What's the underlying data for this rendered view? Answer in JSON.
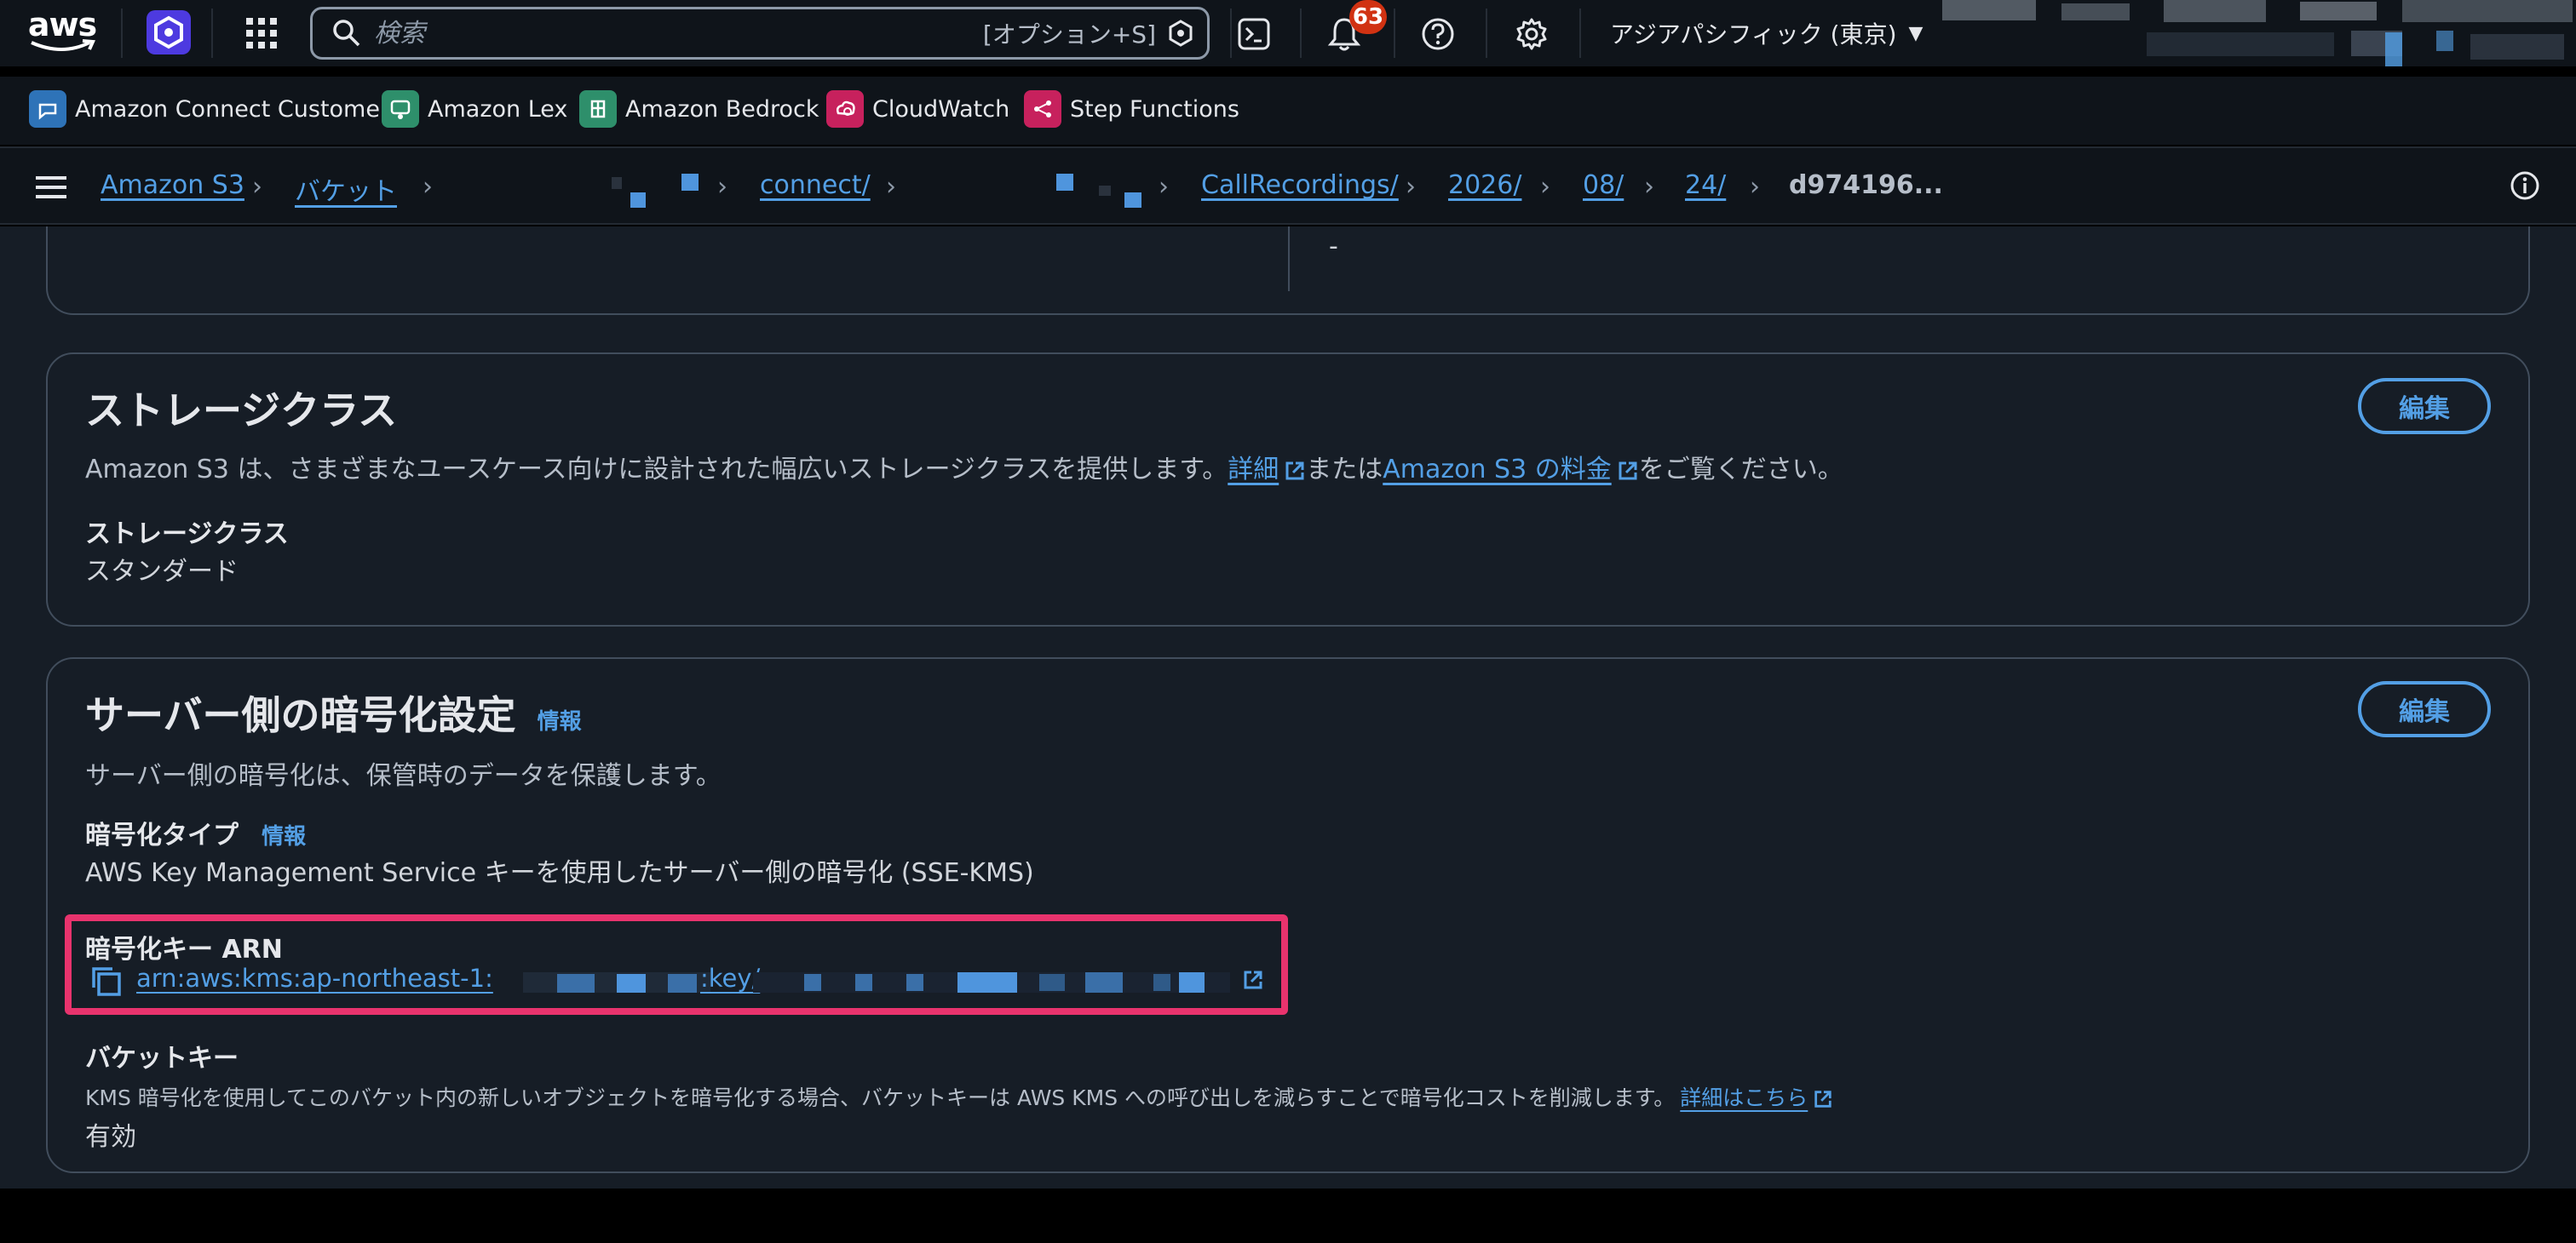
{
  "topnav": {
    "logo_text": "aws",
    "search_placeholder": "検索",
    "search_shortcut": "[オプション+S]",
    "notifications_count": "63",
    "region": "アジアパシフィック (東京)"
  },
  "favorites": [
    {
      "label": "Amazon Connect Customer",
      "color": "#2e73b8"
    },
    {
      "label": "Amazon Lex",
      "color": "#2e8f6b"
    },
    {
      "label": "Amazon Bedrock",
      "color": "#2e8f6b"
    },
    {
      "label": "CloudWatch",
      "color": "#c7215d"
    },
    {
      "label": "Step Functions",
      "color": "#c7215d"
    }
  ],
  "breadcrumb": {
    "items": [
      "Amazon S3",
      "バケット",
      "connect/",
      "CallRecordings/",
      "2026/",
      "08/",
      "24/"
    ],
    "current": "d974196..."
  },
  "prev_section": {
    "value": "-"
  },
  "storage_class": {
    "title": "ストレージクラス",
    "desc_prefix": "Amazon S3 は、さまざまなユースケース向けに設計された幅広いストレージクラスを提供します。",
    "details_link": "詳細",
    "desc_middle": "または",
    "pricing_link": "Amazon S3 の料金",
    "desc_suffix": "をご覧ください。",
    "field_label": "ストレージクラス",
    "field_value": "スタンダード",
    "edit_label": "編集"
  },
  "encryption": {
    "title": "サーバー側の暗号化設定",
    "info": "情報",
    "desc": "サーバー側の暗号化は、保管時のデータを保護します。",
    "type_label": "暗号化タイプ",
    "type_info": "情報",
    "type_value": "AWS Key Management Service キーを使用したサーバー側の暗号化 (SSE-KMS)",
    "arn_label": "暗号化キー ARN",
    "arn_prefix": "arn:aws:kms:ap-northeast-1:",
    "arn_key_part": ":key/",
    "bucket_key_label": "バケットキー",
    "bucket_key_desc": "KMS 暗号化を使用してこのバケット内の新しいオブジェクトを暗号化する場合、バケットキーは AWS KMS への呼び出しを減らすことで暗号化コストを削減します。",
    "bucket_key_link": "詳細はこちら",
    "bucket_key_value": "有効",
    "edit_label": "編集"
  },
  "colors": {
    "accent": "#539fe5",
    "highlight": "#e8336d",
    "background": "#161d26",
    "nav": "#0f141a",
    "badge": "#d13212"
  }
}
